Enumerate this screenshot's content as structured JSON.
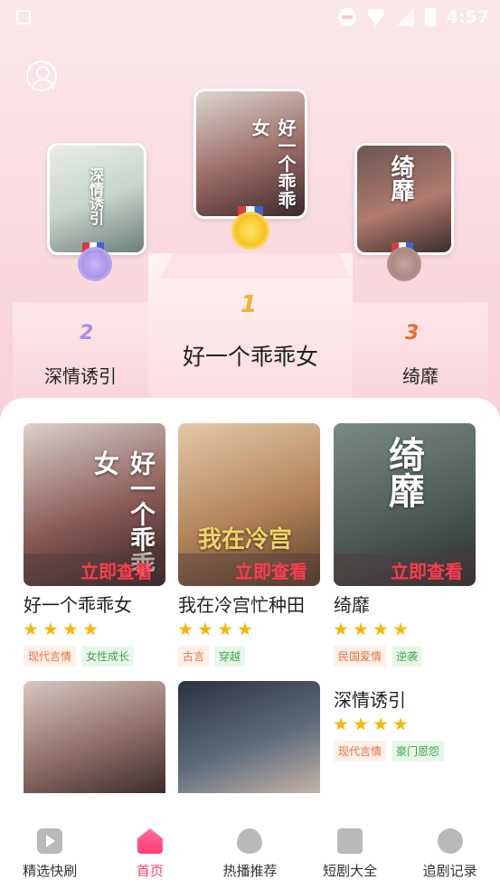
{
  "status_bar": {
    "time": "4:57",
    "icons": [
      "app-a-icon",
      "dnd-icon",
      "wifi-icon",
      "no-signal-icon",
      "battery-icon"
    ]
  },
  "podium": [
    {
      "rank": "1",
      "title": "好一个乖乖女",
      "poster_text": "好一个乖乖女",
      "medal": "gold"
    },
    {
      "rank": "2",
      "title": "深情诱引",
      "poster_text": "深情诱引",
      "medal": "silver"
    },
    {
      "rank": "3",
      "title": "绮靡",
      "poster_text": "绮靡",
      "medal": "bronze"
    }
  ],
  "cards": [
    {
      "title": "好一个乖乖女",
      "cta": "立即查看",
      "poster_text": "好一个乖乖女",
      "rating": 4,
      "tags": [
        "现代言情",
        "女性成长"
      ]
    },
    {
      "title": "我在冷宫忙种田",
      "cta": "立即查看",
      "poster_text": "我在冷宫",
      "rating": 4,
      "tags": [
        "古言",
        "穿越"
      ]
    },
    {
      "title": "绮靡",
      "cta": "立即查看",
      "poster_text": "绮靡",
      "rating": 4,
      "tags": [
        "民国爱情",
        "逆袭"
      ]
    },
    {
      "title": "",
      "cta": "",
      "rating": 0,
      "tags": []
    },
    {
      "title": "",
      "cta": "",
      "rating": 0,
      "tags": []
    },
    {
      "title": "深情诱引",
      "cta": "",
      "rating": 4,
      "tags": [
        "现代言情",
        "豪门恩怨"
      ]
    }
  ],
  "bottom_nav": [
    {
      "label": "精选快刷",
      "icon": "play-icon",
      "active": false
    },
    {
      "label": "首页",
      "icon": "home-icon",
      "active": true
    },
    {
      "label": "热播推荐",
      "icon": "fire-icon",
      "active": false
    },
    {
      "label": "短剧大全",
      "icon": "tv-icon",
      "active": false
    },
    {
      "label": "追剧记录",
      "icon": "clock-icon",
      "active": false
    }
  ],
  "colors": {
    "accent": "#ff3d6e",
    "cta": "#ff3b4f",
    "star": "#f6b800",
    "gold": "#f0b232",
    "silver": "#a38ee8",
    "bronze": "#f06a2c"
  }
}
